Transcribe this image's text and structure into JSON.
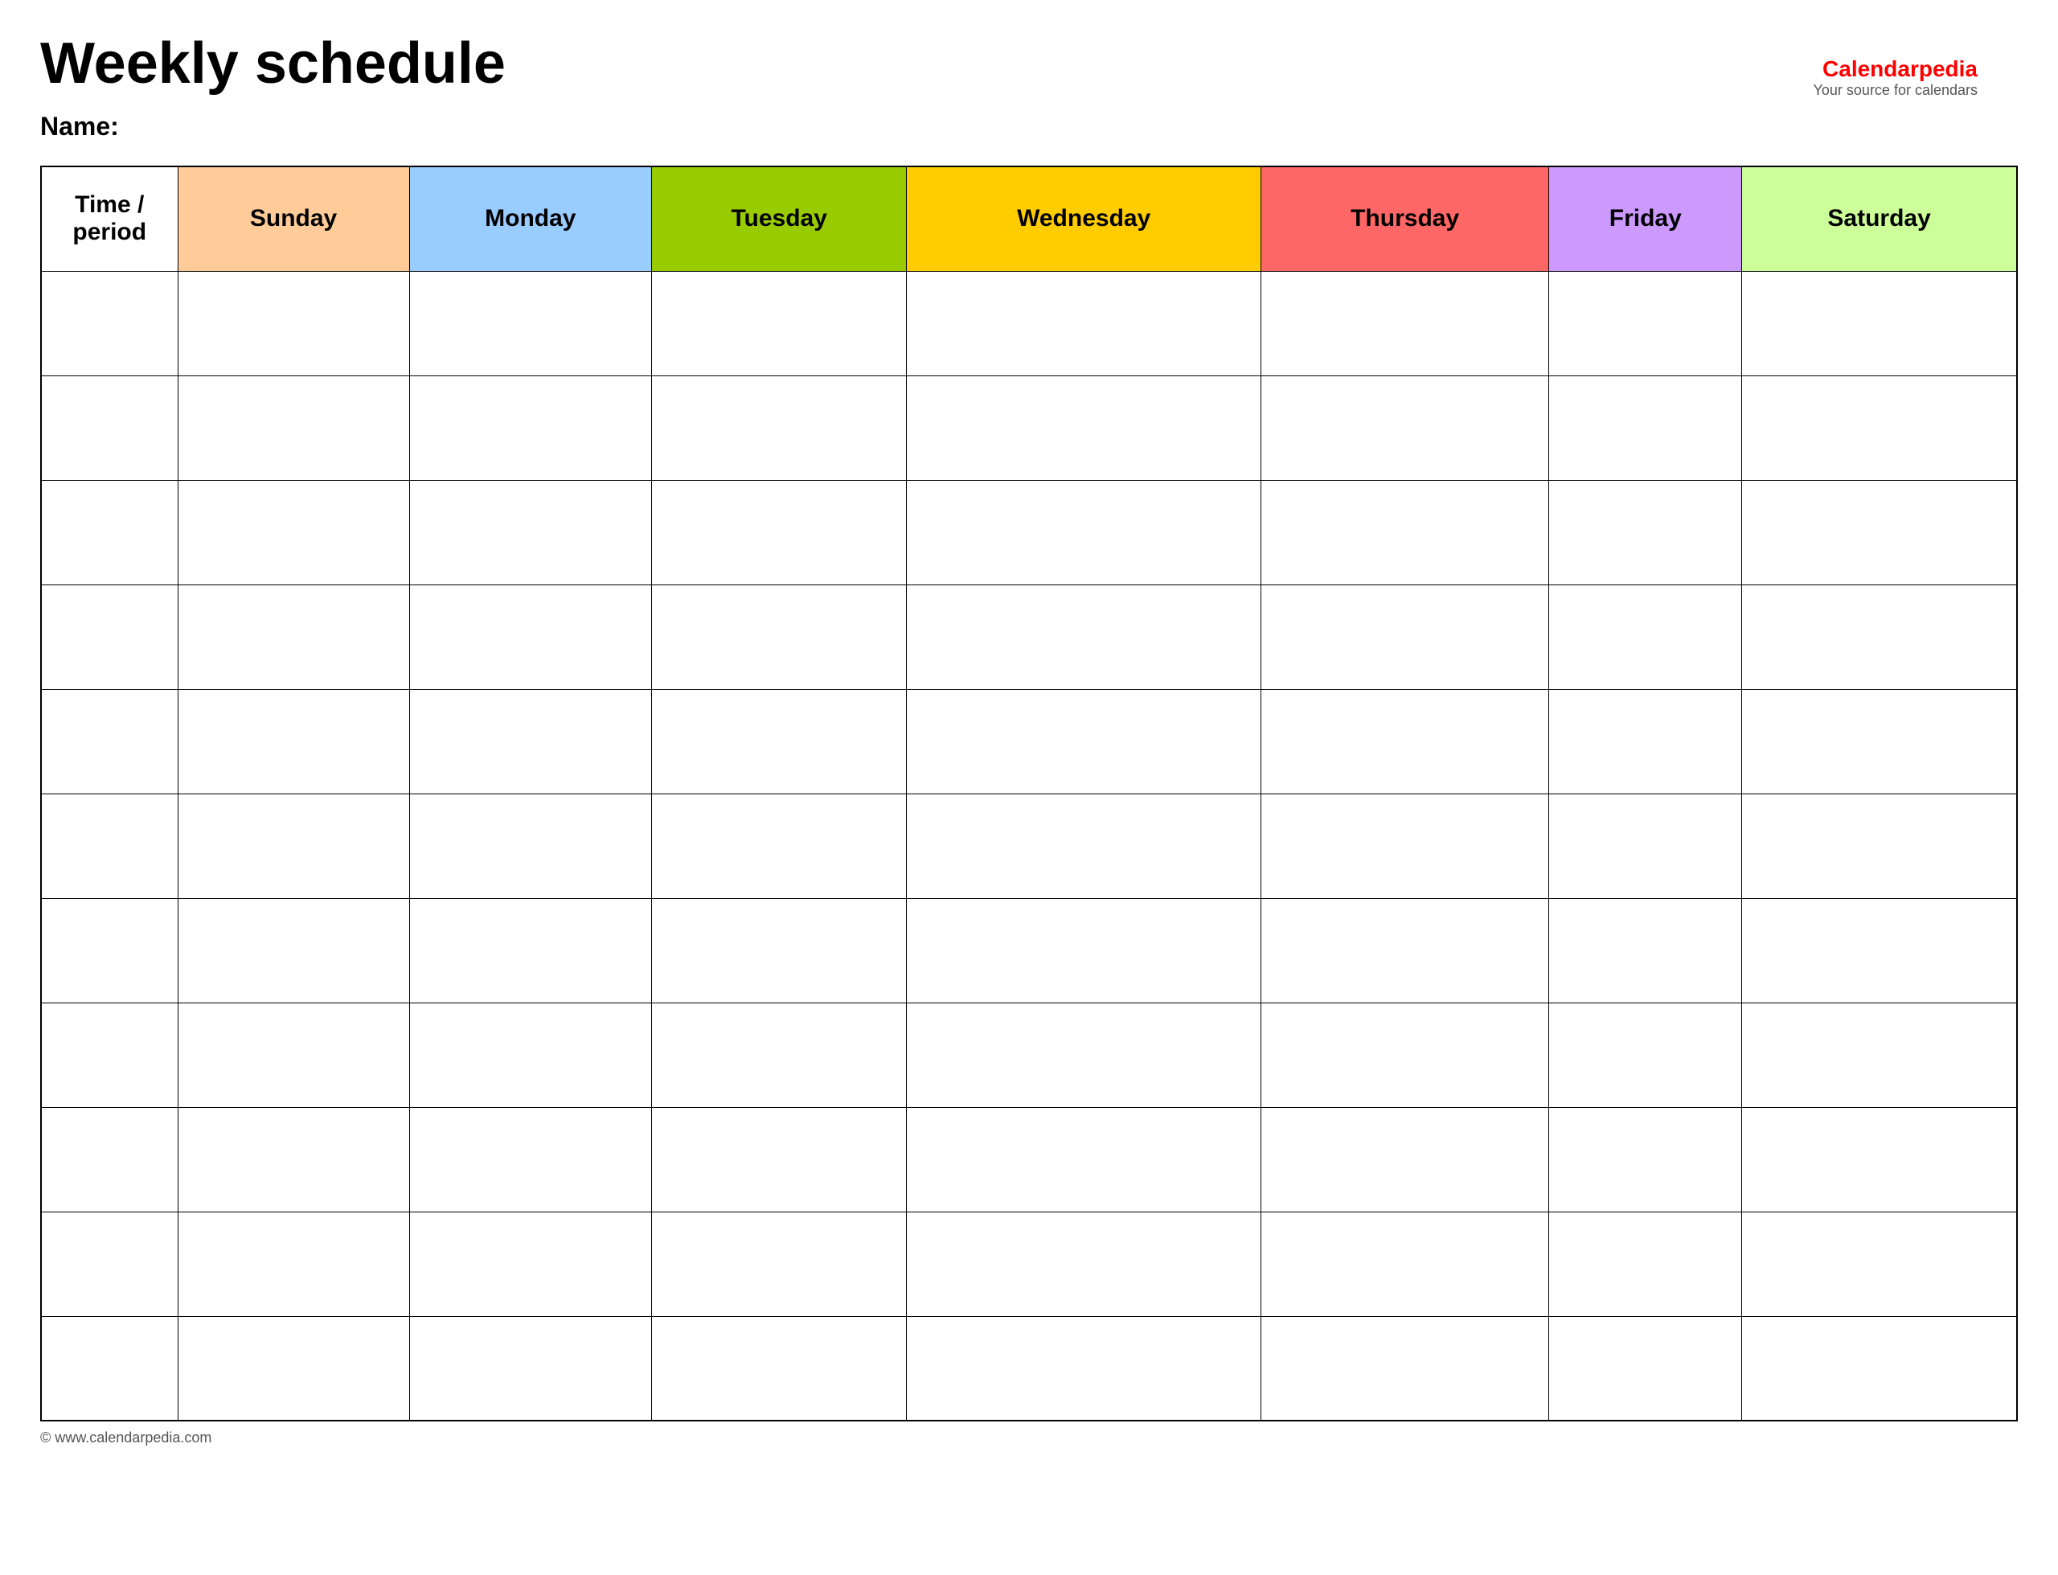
{
  "title": "Weekly schedule",
  "name_label": "Name:",
  "logo": {
    "brand_start": "Calendar",
    "brand_red": "pedia",
    "subtitle": "Your source for calendars"
  },
  "columns": {
    "time_period": "Time / period",
    "sunday": "Sunday",
    "monday": "Monday",
    "tuesday": "Tuesday",
    "wednesday": "Wednesday",
    "thursday": "Thursday",
    "friday": "Friday",
    "saturday": "Saturday"
  },
  "colors": {
    "sunday": "#ffcc99",
    "monday": "#99ccff",
    "tuesday": "#99cc00",
    "wednesday": "#ffcc00",
    "thursday": "#ff6666",
    "friday": "#cc99ff",
    "saturday": "#ccff99"
  },
  "num_rows": 11,
  "footer": "© www.calendarpedia.com"
}
